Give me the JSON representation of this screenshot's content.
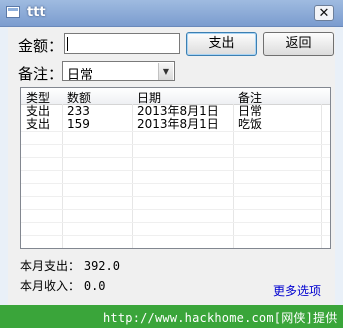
{
  "window": {
    "title": "ttt",
    "close_glyph": "✕"
  },
  "form": {
    "amount_label": "金额：",
    "amount_value": "",
    "note_label": "备注：",
    "note_selected": "日常",
    "expense_button": "支出",
    "back_button": "返回"
  },
  "table": {
    "columns": [
      "类型",
      "数额",
      "日期",
      "备注"
    ],
    "rows": [
      [
        "支出",
        "233",
        "2013年8月1日",
        "日常"
      ],
      [
        "支出",
        "159",
        "2013年8月1日",
        "吃饭"
      ]
    ]
  },
  "summary": {
    "expense_label": "本月支出：",
    "expense_value": "392.0",
    "income_label": "本月收入：",
    "income_value": "0.0",
    "more_options": "更多选项"
  },
  "footer": {
    "watermark": "http://www.hackhome.com[网侠]提供"
  },
  "colors": {
    "footer_bg": "#3aa53a",
    "link": "#0000d0",
    "titlebar": "#8aa9d6"
  }
}
